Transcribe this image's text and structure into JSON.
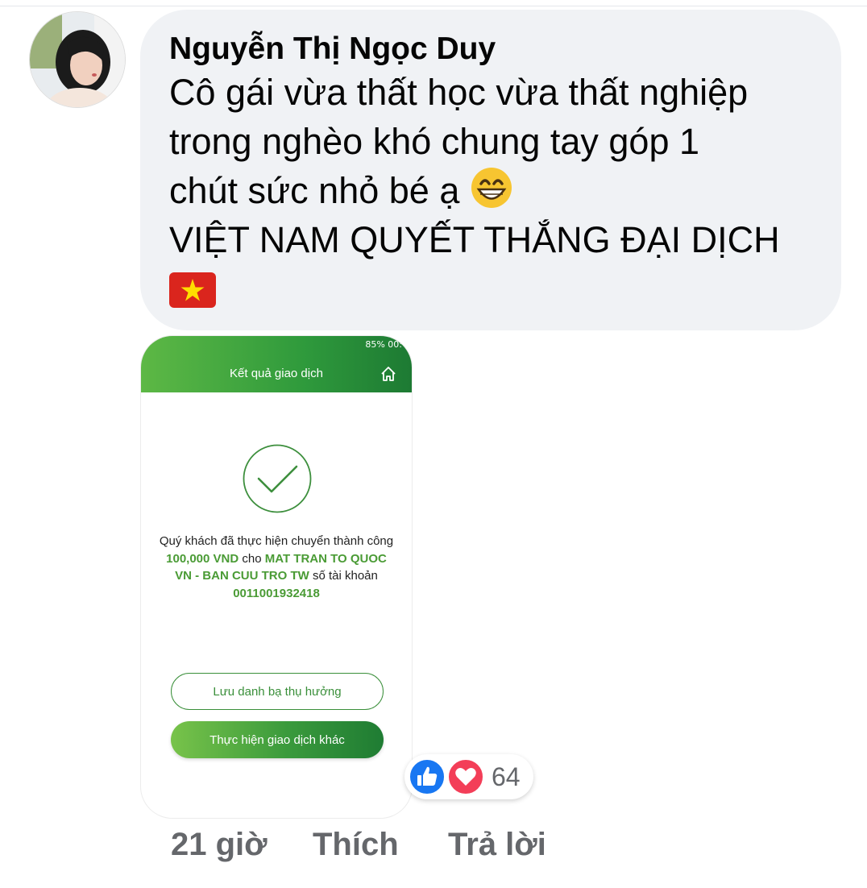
{
  "comment": {
    "author": "Nguyễn Thị Ngọc Duy",
    "lines": [
      "Cô gái vừa thất học vừa thất nghiệp",
      "trong nghèo khó chung tay góp 1",
      "chút sức nhỏ bé ạ",
      "VIỆT NAM QUYẾT THẮNG ĐẠI DỊCH"
    ],
    "emoji_icon": "grinning-face-icon",
    "flag_icon": "vietnam-flag-icon"
  },
  "attachment": {
    "status_bar": "85% 00:",
    "header_title": "Kết quả giao dịch",
    "home_icon": "home-icon",
    "success_icon": "check-circle-icon",
    "message": {
      "part1": "Quý khách đã thực hiện chuyển thành công ",
      "amount": "100,000 VND",
      "part2": " cho ",
      "recipient": "MAT TRAN TO QUOC VN - BAN CUU TRO TW",
      "part3": " số tài khoản ",
      "account": "0011001932418"
    },
    "save_button": "Lưu danh bạ thụ hưởng",
    "other_button": "Thực hiện giao dịch khác",
    "colors": {
      "brand_green": "#3a9a3c",
      "highlight": "#4a9b35"
    }
  },
  "reactions": {
    "icons": [
      "like-icon",
      "love-icon"
    ],
    "count": "64"
  },
  "actions": {
    "time": "21 giờ",
    "like": "Thích",
    "reply": "Trả lời"
  }
}
